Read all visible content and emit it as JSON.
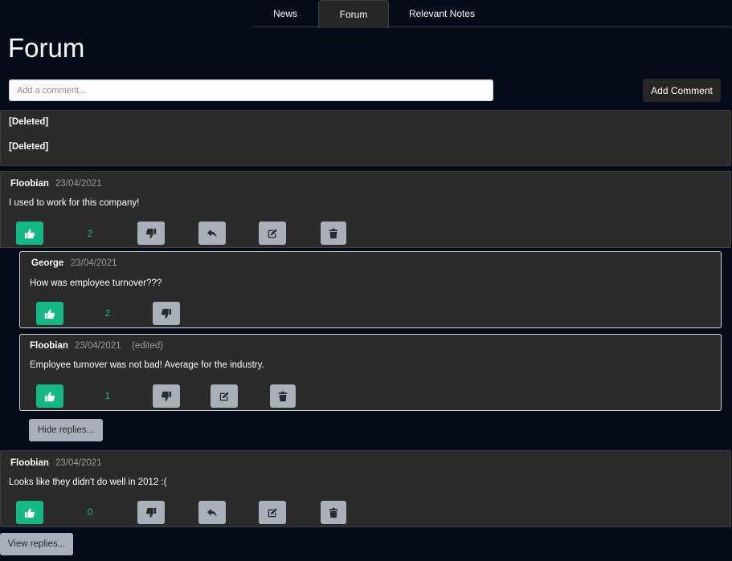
{
  "tabs": [
    {
      "label": "News"
    },
    {
      "label": "Forum"
    },
    {
      "label": "Relevant Notes"
    }
  ],
  "page_title": "Forum",
  "comment_box": {
    "placeholder": "Add a comment...",
    "value": "",
    "submit_label": "Add Comment"
  },
  "comments": [
    {
      "author": "[Deleted]",
      "body": "[Deleted]"
    },
    {
      "author": "Floobian",
      "date": "23/04/2021",
      "body": "I used to work for this company!",
      "likes": "2",
      "replies": [
        {
          "author": "George",
          "date": "23/04/2021",
          "body": "How was employee turnover???",
          "likes": "2"
        },
        {
          "author": "Floobian",
          "date": "23/04/2021",
          "edited": "(edited)",
          "body": "Employee turnover was not bad! Average for the industry.",
          "likes": "1"
        }
      ],
      "toggle_label": "Hide replies..."
    },
    {
      "author": "Floobian",
      "date": "23/04/2021",
      "body": "Looks like they didn't do well in 2012 :(",
      "likes": "0",
      "toggle_label": "View replies..."
    }
  ],
  "icons": {
    "like": "thumbs-up-icon",
    "dislike": "thumbs-down-icon",
    "reply": "reply-icon",
    "edit": "edit-icon",
    "delete": "trash-icon"
  },
  "colors": {
    "background": "#050b18",
    "card": "#2b2b2b",
    "accent": "#14b885",
    "button_grey": "#a9b0b9"
  }
}
